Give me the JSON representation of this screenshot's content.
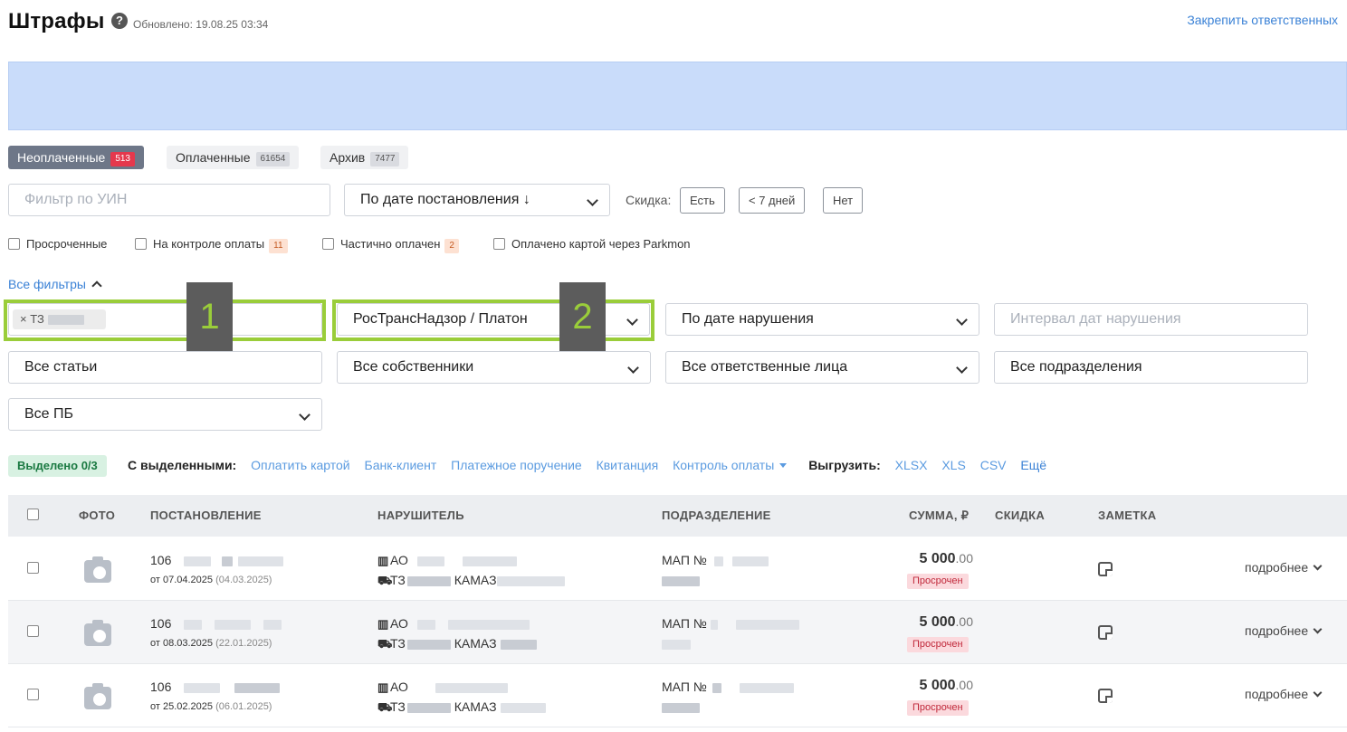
{
  "header": {
    "title": "Штрафы",
    "updated": "Обновлено: 19.08.25 03:34",
    "pin_link": "Закрепить ответственных"
  },
  "tabs": [
    {
      "label": "Неоплаченные",
      "count": "513",
      "active": true
    },
    {
      "label": "Оплаченные",
      "count": "61654",
      "active": false
    },
    {
      "label": "Архив",
      "count": "7477",
      "active": false
    }
  ],
  "filters": {
    "uin_placeholder": "Фильтр по УИН",
    "sort_value": "По дате постановления ↓",
    "discount_label": "Скидка:",
    "discount_options": [
      "Есть",
      "< 7 дней",
      "Нет"
    ],
    "checkboxes": [
      {
        "label": "Просроченные"
      },
      {
        "label": "На контроле оплаты",
        "badge": "11"
      },
      {
        "label": "Частично оплачен",
        "badge": "2"
      },
      {
        "label": "Оплачено картой через Parkmon"
      }
    ],
    "all_filters": "Все фильтры",
    "vehicle_tag": "ТЗ",
    "source_select": "РосТрансНадзор / Платон",
    "violation_date_sort": "По дате нарушения",
    "violation_interval_placeholder": "Интервал дат нарушения",
    "articles": "Все статьи",
    "owners": "Все собственники",
    "responsible": "Все ответственные лица",
    "divisions": "Все подразделения",
    "pb": "Все ПБ"
  },
  "annotations": [
    "1",
    "2"
  ],
  "colors": {
    "highlight": "#9acd3a",
    "link": "#3b82d6",
    "overdue": "#c0283a",
    "banner": "#c9dcfa"
  },
  "bulk": {
    "selected": "Выделено 0/3",
    "with_selected": "С выделенными:",
    "actions": [
      "Оплатить картой",
      "Банк-клиент",
      "Платежное поручение",
      "Квитанция",
      "Контроль оплаты"
    ],
    "export_label": "Выгрузить:",
    "export_formats": [
      "XLSX",
      "XLS",
      "CSV",
      "Ещё"
    ]
  },
  "table": {
    "columns": [
      "ФОТО",
      "ПОСТАНОВЛЕНИЕ",
      "НАРУШИТЕЛЬ",
      "ПОДРАЗДЕЛЕНИЕ",
      "СУММА, ₽",
      "СКИДКА",
      "ЗАМЕТКА"
    ],
    "rows": [
      {
        "decree": "106",
        "date": "от 07.04.2025",
        "date2": "(04.03.2025)",
        "org": "АО",
        "vehicle": "ТЗ",
        "model": "КАМАЗ",
        "division": "МАП №",
        "amount": "5 000",
        "amount_dec": ".00",
        "status": "Просрочен",
        "more": "подробнее"
      },
      {
        "decree": "106",
        "date": "от 08.03.2025",
        "date2": "(22.01.2025)",
        "org": "АО",
        "vehicle": "ТЗ",
        "model": "КАМАЗ",
        "division": "МАП №",
        "amount": "5 000",
        "amount_dec": ".00",
        "status": "Просрочен",
        "more": "подробнее"
      },
      {
        "decree": "106",
        "date": "от 25.02.2025",
        "date2": "(06.01.2025)",
        "org": "АО",
        "vehicle": "ТЗ",
        "model": "КАМАЗ",
        "division": "МАП №",
        "amount": "5 000",
        "amount_dec": ".00",
        "status": "Просрочен",
        "more": "подробнее"
      }
    ]
  }
}
